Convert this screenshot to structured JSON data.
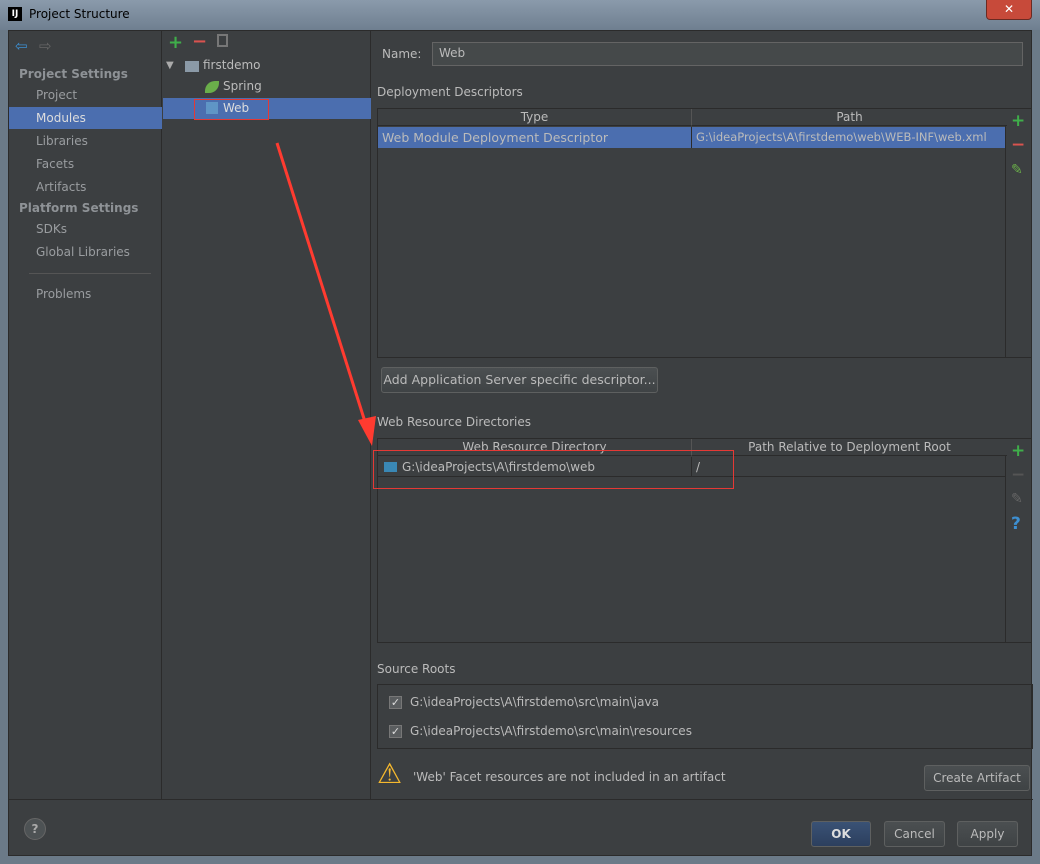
{
  "window": {
    "title": "Project Structure",
    "app_icon": "IJ",
    "close": "✕"
  },
  "sidebar": {
    "headers": [
      "Project Settings",
      "Platform Settings"
    ],
    "project_items": [
      "Project",
      "Modules",
      "Libraries",
      "Facets",
      "Artifacts"
    ],
    "platform_items": [
      "SDKs",
      "Global Libraries"
    ],
    "problems": "Problems"
  },
  "tree": {
    "root": "firstdemo",
    "children": [
      "Spring",
      "Web"
    ],
    "selected": "Web"
  },
  "name_field": {
    "label": "Name:",
    "value": "Web"
  },
  "deployment": {
    "title": "Deployment Descriptors",
    "columns": [
      "Type",
      "Path"
    ],
    "rows": [
      {
        "type": "Web Module Deployment Descriptor",
        "path": "G:\\ideaProjects\\A\\firstdemo\\web\\WEB-INF\\web.xml"
      }
    ],
    "add_server_button": "Add Application Server specific descriptor..."
  },
  "web_resources": {
    "title": "Web Resource Directories",
    "columns": [
      "Web Resource Directory",
      "Path Relative to Deployment Root"
    ],
    "rows": [
      {
        "dir": "G:\\ideaProjects\\A\\firstdemo\\web",
        "path": "/"
      }
    ]
  },
  "source_roots": {
    "title": "Source Roots",
    "items": [
      {
        "path": "G:\\ideaProjects\\A\\firstdemo\\src\\main\\java",
        "checked": true
      },
      {
        "path": "G:\\ideaProjects\\A\\firstdemo\\src\\main\\resources",
        "checked": true
      }
    ]
  },
  "warning": {
    "text": "'Web' Facet resources are not included in an artifact",
    "button": "Create Artifact"
  },
  "footer": {
    "ok": "OK",
    "cancel": "Cancel",
    "apply": "Apply",
    "help": "?"
  },
  "colors": {
    "selection": "#4b6eaf",
    "background": "#3c3f41",
    "annotation": "#ff3b30",
    "add": "#3fae4a",
    "remove": "#d9534f"
  }
}
